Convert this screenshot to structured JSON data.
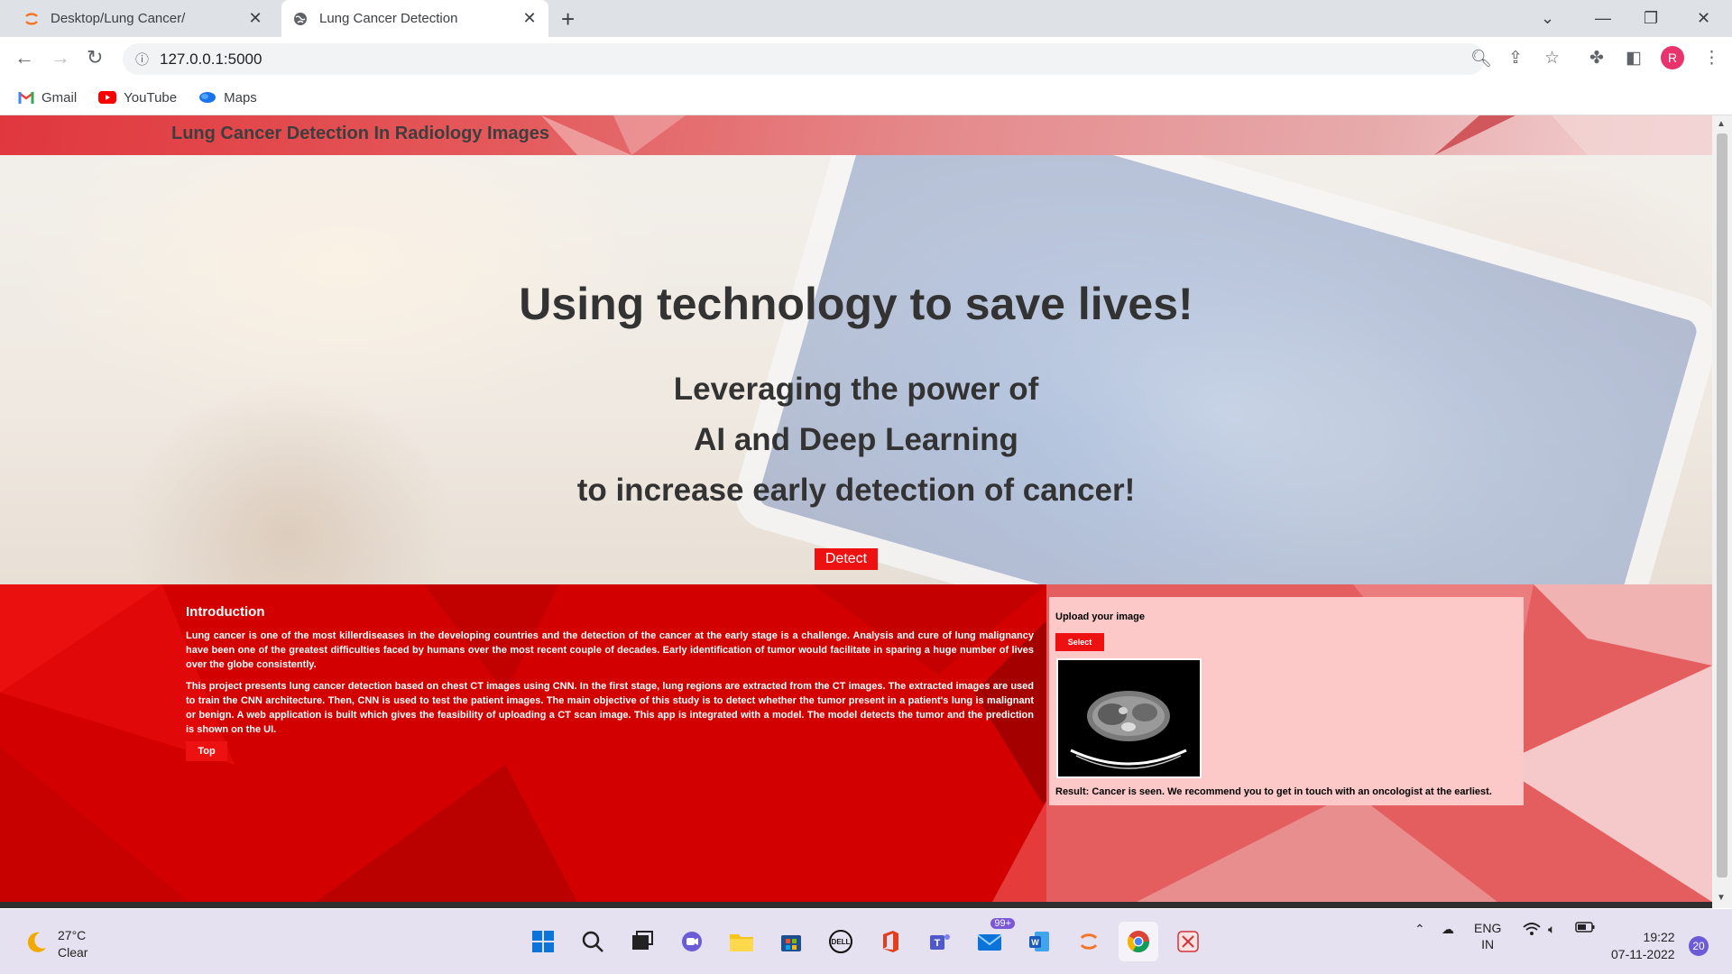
{
  "browser": {
    "tabs": [
      {
        "title": "Desktop/Lung Cancer/",
        "icon": "jupyter-icon",
        "active": false
      },
      {
        "title": "Lung Cancer Detection",
        "icon": "globe-icon",
        "active": true
      }
    ],
    "url": "127.0.0.1:5000",
    "bookmarks": [
      {
        "label": "Gmail",
        "icon": "gmail-icon"
      },
      {
        "label": "YouTube",
        "icon": "youtube-icon"
      },
      {
        "label": "Maps",
        "icon": "maps-icon"
      }
    ],
    "profile_initial": "R"
  },
  "site": {
    "brand": "Lung Cancer Detection In Radiology Images",
    "hero": {
      "headline": "Using technology to save lives!",
      "sub_lines": [
        "Leveraging the power of",
        "AI and Deep Learning",
        "to increase early detection of cancer!"
      ],
      "detect_button": "Detect"
    },
    "intro": {
      "heading": "Introduction",
      "p1": "Lung cancer is one of the most killerdiseases in the developing countries and the detection of the cancer at the early stage is a challenge. Analysis and cure of lung malignancy have been one of the greatest difficulties faced by humans over the most recent couple of decades. Early identification of tumor would facilitate in sparing a huge number of lives over the globe consistently.",
      "p2": "This project presents lung cancer detection based on chest CT images using CNN. In the first stage, lung regions are extracted from the CT images. The extracted images are used to train the CNN architecture. Then, CNN is used to test the patient images. The main objective of this study is to detect whether the tumor present in a patient's lung is malignant or benign. A web application is built which gives the feasibility of uploading a CT scan image. This app is integrated with a model. The model detects the tumor and the prediction is shown on the UI.",
      "top_button": "Top"
    },
    "upload": {
      "label": "Upload your image",
      "select_button": "Select",
      "result": "Result: Cancer is seen. We recommend you to get in touch with an oncologist at the earliest."
    },
    "colors": {
      "accent": "#ee1111",
      "panel": "#fcc8c8",
      "section_red": "#d30000"
    }
  },
  "taskbar": {
    "weather": {
      "temp": "27°C",
      "condition": "Clear"
    },
    "mail_badge": "99+",
    "language": "ENG",
    "region": "IN",
    "time": "19:22",
    "date": "07-11-2022",
    "notifications": "20"
  }
}
